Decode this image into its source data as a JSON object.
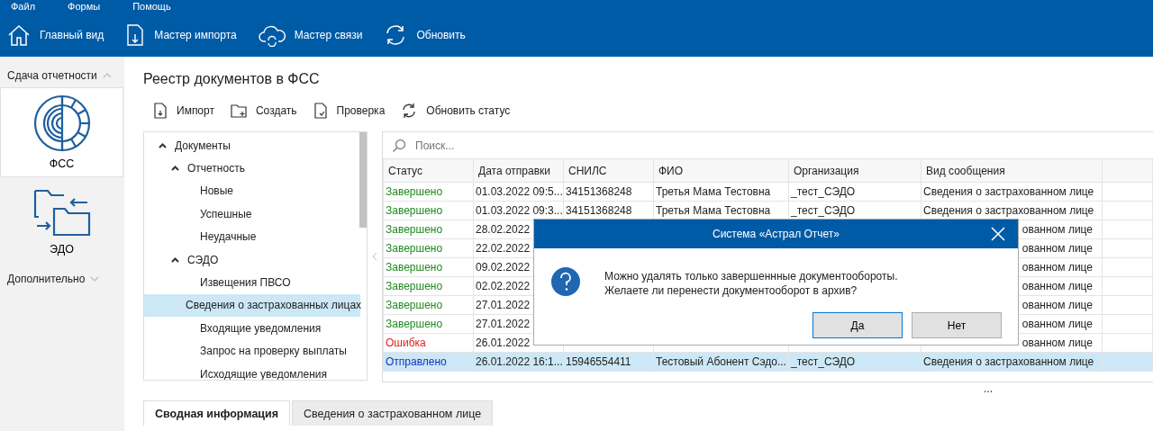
{
  "menu": [
    "Файл",
    "Формы",
    "Помощь"
  ],
  "toolbar": [
    {
      "kind": "home",
      "label": "Главный вид"
    },
    {
      "kind": "import",
      "label": "Мастер импорта"
    },
    {
      "kind": "cloud",
      "label": "Мастер связи"
    },
    {
      "kind": "refresh",
      "label": "Обновить"
    }
  ],
  "sidebar": {
    "sections": [
      {
        "title": "Сдача отчетности",
        "expanded": true,
        "items": [
          {
            "kind": "fss",
            "label": "ФСС",
            "selected": true
          },
          {
            "kind": "edo",
            "label": "ЭДО",
            "selected": false
          }
        ]
      },
      {
        "title": "Дополнительно",
        "expanded": false
      }
    ]
  },
  "page_title": "Реестр документов в ФСС",
  "actions": [
    {
      "kind": "import",
      "label": "Импорт"
    },
    {
      "kind": "create",
      "label": "Создать"
    },
    {
      "kind": "check",
      "label": "Проверка"
    },
    {
      "kind": "refresh",
      "label": "Обновить статус"
    }
  ],
  "tree": [
    {
      "label": "Документы",
      "expanded": true,
      "selected": false,
      "children": [
        {
          "label": "Отчетность",
          "expanded": true,
          "selected": false,
          "children": [
            {
              "label": "Новые",
              "selected": false
            },
            {
              "label": "Успешные",
              "selected": false
            },
            {
              "label": "Неудачные",
              "selected": false
            }
          ]
        },
        {
          "label": "СЭДО",
          "expanded": true,
          "selected": false,
          "children": [
            {
              "label": "Извещения ПВСО",
              "selected": false
            },
            {
              "label": "Сведения о застрахованных лицах",
              "selected": true
            },
            {
              "label": "Входящие уведомления",
              "selected": false
            },
            {
              "label": "Запрос на проверку выплаты",
              "selected": false
            },
            {
              "label": "Исходящие уведомления",
              "selected": false
            }
          ]
        }
      ]
    }
  ],
  "search": {
    "placeholder": "Поиск..."
  },
  "table": {
    "columns": [
      "Статус",
      "Дата отправки",
      "СНИЛС",
      "ФИО",
      "Организация",
      "Вид сообщения"
    ],
    "rows": [
      {
        "color": "#1e8a1e",
        "selected": false,
        "cells": [
          "Завершено",
          "01.03.2022 09:5...",
          "34151368248",
          "Третья Мама Тестовна",
          "_тест_СЭДО",
          "Сведения о застрахованном лице"
        ]
      },
      {
        "color": "#1e8a1e",
        "selected": false,
        "cells": [
          "Завершено",
          "01.03.2022 09:3...",
          "34151368248",
          "Третья Мама Тестовна",
          "_тест_СЭДО",
          "Сведения о застрахованном лице"
        ]
      },
      {
        "color": "#1e8a1e",
        "selected": false,
        "cells": [
          "Завершено",
          "28.02.2022",
          "",
          "",
          "",
          "ованном лице"
        ]
      },
      {
        "color": "#1e8a1e",
        "selected": false,
        "cells": [
          "Завершено",
          "22.02.2022",
          "",
          "",
          "",
          "ованном лице"
        ]
      },
      {
        "color": "#1e8a1e",
        "selected": false,
        "cells": [
          "Завершено",
          "09.02.2022",
          "",
          "",
          "",
          "ованном лице"
        ]
      },
      {
        "color": "#1e8a1e",
        "selected": false,
        "cells": [
          "Завершено",
          "02.02.2022",
          "",
          "",
          "",
          "ованном лице"
        ]
      },
      {
        "color": "#1e8a1e",
        "selected": false,
        "cells": [
          "Завершено",
          "27.01.2022",
          "",
          "",
          "",
          "ованном лице"
        ]
      },
      {
        "color": "#1e8a1e",
        "selected": false,
        "cells": [
          "Завершено",
          "27.01.2022",
          "",
          "",
          "",
          "ованном лице"
        ]
      },
      {
        "color": "#e0201e",
        "selected": false,
        "cells": [
          "Ошибка",
          "26.01.2022",
          "",
          "",
          "",
          "ованном лице"
        ]
      },
      {
        "color": "#1a2fc0",
        "selected": true,
        "cells": [
          "Отправлено",
          "26.01.2022 16:1...",
          "15946554411",
          "Тестовый Абонент Сэдо...",
          "_тест_СЭДО",
          "Сведения о застрахованном лице"
        ]
      }
    ]
  },
  "more": "...",
  "bottom_tabs": [
    {
      "label": "Сводная информация",
      "selected": true
    },
    {
      "label": "Сведения о застрахованном лице",
      "selected": false
    }
  ],
  "dialog": {
    "title": "Система «Астрал Отчет»",
    "message": [
      "Можно удалять только завершеннные документообороты.",
      "Желаете ли перенести документооборот в архив?"
    ],
    "buttons": [
      {
        "label": "Да",
        "selected": true
      },
      {
        "label": "Нет",
        "selected": false
      }
    ]
  }
}
